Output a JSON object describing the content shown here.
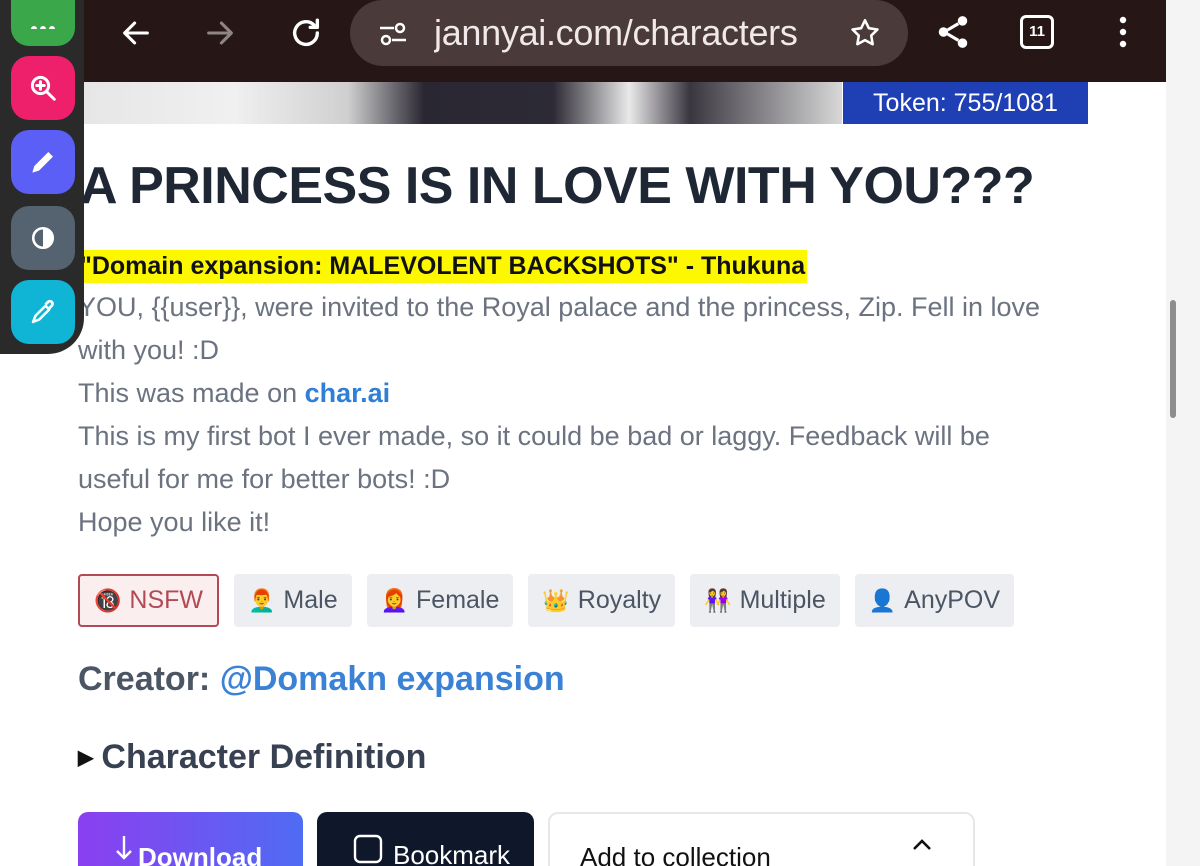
{
  "browser": {
    "url": "jannyai.com/characters",
    "tab_count": "11"
  },
  "token": "Token: 755/1081",
  "title": "A PRINCESS IS IN LOVE WITH YOU???",
  "quote": "\"Domain expansion: MALEVOLENT BACKSHOTS\" - Thukuna",
  "description": {
    "line1": "YOU, {{user}}, were invited to the Royal palace and the princess, Zip. Fell in love",
    "line2": "with you! :D",
    "line3_prefix": "This was made on ",
    "line3_link": "char.ai",
    "line4": "This is my first bot I ever made, so it could be bad or laggy. Feedback will be",
    "line5": "useful for me for better bots! :D",
    "line6": "Hope you like it!"
  },
  "tags": [
    {
      "emoji": "🔞",
      "label": "NSFW"
    },
    {
      "emoji": "👨‍🦰",
      "label": "Male"
    },
    {
      "emoji": "👩‍🦰",
      "label": "Female"
    },
    {
      "emoji": "👑",
      "label": "Royalty"
    },
    {
      "emoji": "👭",
      "label": "Multiple"
    },
    {
      "emoji": "👤",
      "label": "AnyPOV"
    }
  ],
  "creator": {
    "label": "Creator: ",
    "name": "@Domakn expansion"
  },
  "character_definition": "Character Definition",
  "buttons": {
    "download": "Download",
    "bookmark": "Bookmark",
    "collection": "Add to collection"
  },
  "colors": {
    "browser_bar": "#271616",
    "token_badge": "#1f3fb5",
    "highlight": "#fdf700",
    "link": "#3b82d6",
    "tool_green": "#3aa84a",
    "tool_pink": "#ee1f6b",
    "tool_indigo": "#5b5ff5",
    "tool_gray": "#556270",
    "tool_cyan": "#10b5d6"
  },
  "toolbar": {
    "items": [
      "more-icon",
      "zoom-in-icon",
      "pencil-icon",
      "contrast-icon",
      "eyedropper-icon"
    ]
  }
}
